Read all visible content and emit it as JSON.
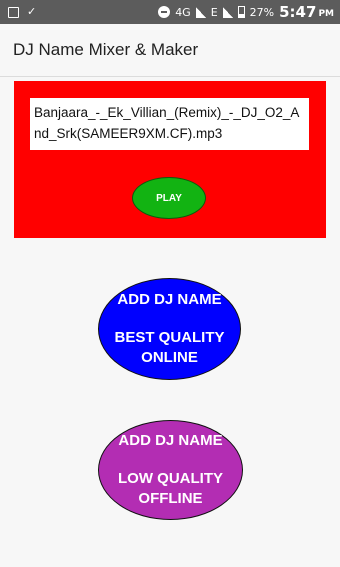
{
  "status_bar": {
    "network": "4G",
    "network2": "E",
    "battery": "27%",
    "time": "5:47",
    "ampm": "PM"
  },
  "app_bar": {
    "title": "DJ Name Mixer & Maker"
  },
  "player": {
    "file_name": "Banjaara_-_Ek_Villian_(Remix)_-_DJ_O2_And_Srk(SAMEER9XM.CF).mp3",
    "play_label": "PLAY",
    "background": "#ff0000",
    "play_color": "#12b312"
  },
  "actions": {
    "online": {
      "line1": "ADD DJ NAME",
      "line2": "BEST QUALITY",
      "line3": "ONLINE",
      "color": "#0000ff"
    },
    "offline": {
      "line1": "ADD DJ NAME",
      "line2": "LOW QUALITY",
      "line3": "OFFLINE",
      "color": "#b32db3"
    }
  }
}
